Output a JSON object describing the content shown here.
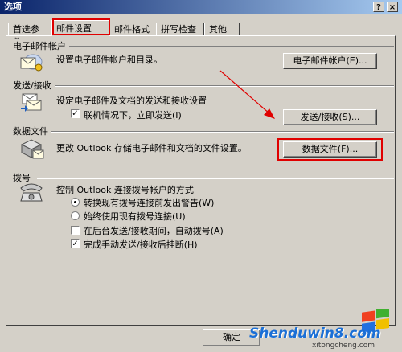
{
  "window": {
    "title": "选项",
    "help_glyph": "?",
    "close_glyph": "×"
  },
  "tabs": [
    {
      "label": "首选参数"
    },
    {
      "label": "邮件设置"
    },
    {
      "label": "邮件格式"
    },
    {
      "label": "拼写检查"
    },
    {
      "label": "其他"
    }
  ],
  "groups": {
    "email_accounts": {
      "header": "电子邮件帐户",
      "description": "设置电子邮件帐户和目录。",
      "button": "电子邮件帐户(E)..."
    },
    "send_receive": {
      "header": "发送/接收",
      "description": "设定电子邮件及文档的发送和接收设置",
      "checkbox_label": "联机情况下，立即发送(I)",
      "button": "发送/接收(S)..."
    },
    "data_files": {
      "header": "数据文件",
      "description": "更改 Outlook 存储电子邮件和文档的文件设置。",
      "button": "数据文件(F)..."
    },
    "dialup": {
      "header": "拨号",
      "description": "控制 Outlook 连接拨号帐户的方式",
      "options": [
        {
          "label": "转换现有拨号连接前发出警告(W)"
        },
        {
          "label": "始终使用现有拨号连接(U)"
        },
        {
          "label": "在后台发送/接收期间，自动拨号(A)"
        },
        {
          "label": "完成手动发送/接收后挂断(H)"
        }
      ]
    }
  },
  "footer": {
    "ok_button": "确定"
  },
  "watermark": {
    "main": "Shenduwin8.com",
    "sub": "xitongcheng.com"
  },
  "colors": {
    "highlight": "#e00000",
    "titlebar": "#0a246a",
    "dialog_bg": "#d4d0c8"
  }
}
